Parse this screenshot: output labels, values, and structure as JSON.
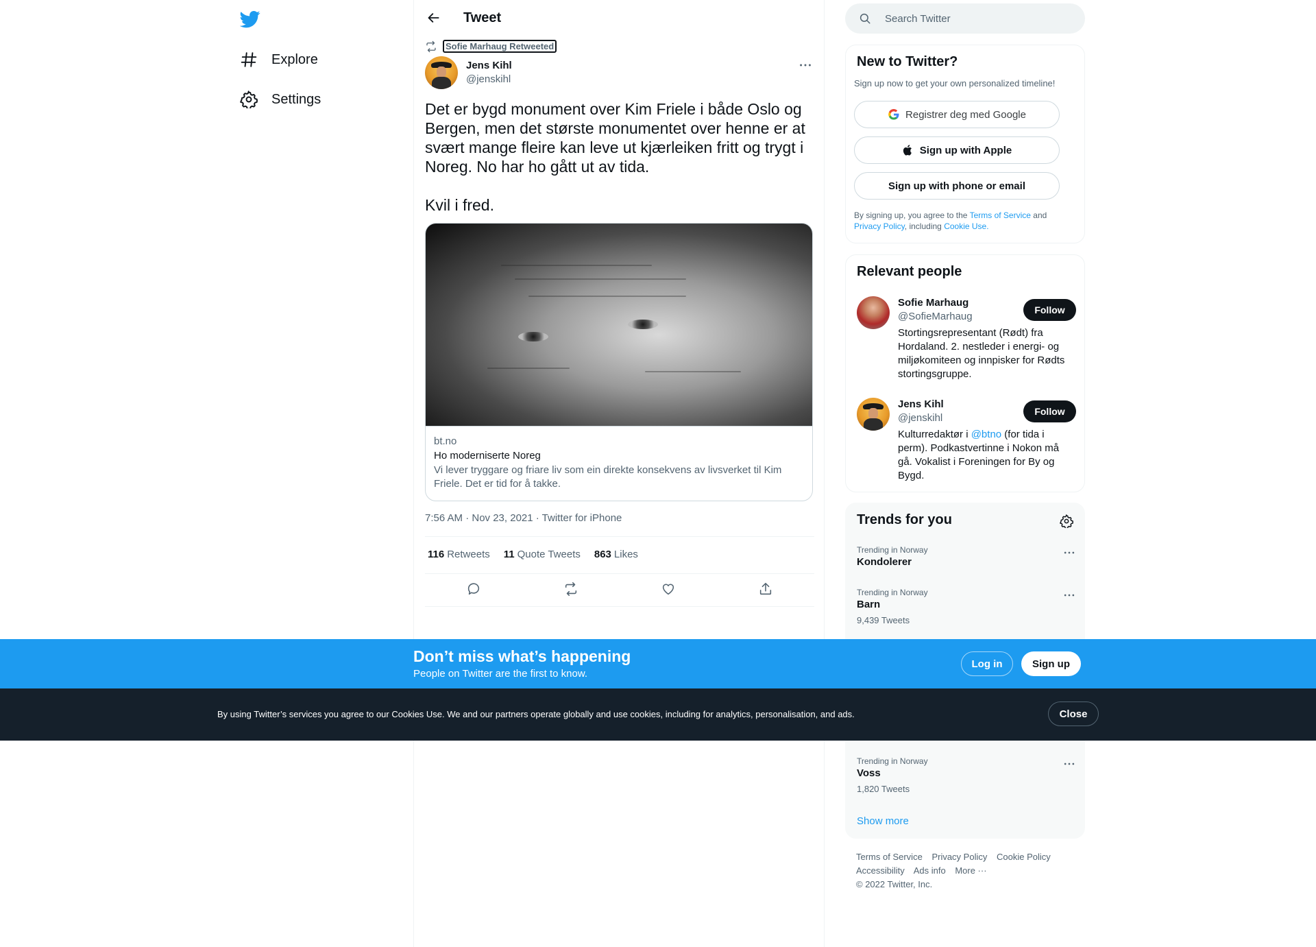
{
  "nav": {
    "explore_label": "Explore",
    "settings_label": "Settings"
  },
  "header": {
    "title": "Tweet"
  },
  "tweet": {
    "retweeted_by": "Sofie Marhaug Retweeted",
    "author_name": "Jens Kihl",
    "author_handle": "@jenskihl",
    "text": "Det er bygd monument over Kim Friele i både Oslo og Bergen, men det største monumentet over henne er at svært mange fleire kan leve ut kjærleiken fritt og trygt i Noreg. No har ho gått ut av tida.\n\nKvil i fred.",
    "card": {
      "domain": "bt.no",
      "title": "Ho moderniserte Noreg",
      "description": "Vi lever tryggare og friare liv som ein direkte konsekvens av livsverket til Kim Friele. Det er tid for å takke."
    },
    "timestamp": "7:56 AM · Nov 23, 2021 · Twitter for iPhone",
    "stats": {
      "retweets_count": "116",
      "retweets_label": "Retweets",
      "quotes_count": "11",
      "quotes_label": "Quote Tweets",
      "likes_count": "863",
      "likes_label": "Likes"
    }
  },
  "search": {
    "placeholder": "Search Twitter"
  },
  "signup_panel": {
    "title": "New to Twitter?",
    "subtitle": "Sign up now to get your own personalized timeline!",
    "google_label": "Registrer deg med Google",
    "apple_label": "Sign up with Apple",
    "phone_label": "Sign up with phone or email",
    "legal_prefix": "By signing up, you agree to the",
    "terms": "Terms of Service",
    "and": "and",
    "privacy": "Privacy Policy",
    "including": ", including",
    "cookie_use": "Cookie Use."
  },
  "people_panel": {
    "title": "Relevant people",
    "people": [
      {
        "name": "Sofie Marhaug",
        "handle": "@SofieMarhaug",
        "bio": "Stortingsrepresentant (Rødt) fra Hordaland. 2. nestleder i energi- og miljøkomiteen og innpisker for Rødts stortingsgruppe.",
        "follow": "Follow"
      },
      {
        "name": "Jens Kihl",
        "handle": "@jenskihl",
        "bio_prefix": "Kulturredaktør i ",
        "bio_mention": "@btno",
        "bio_suffix": " (for tida i perm). Podkastvertinne i Nokon må gå. Vokalist i Foreningen for By og Bygd.",
        "follow": "Follow"
      }
    ]
  },
  "trends_panel": {
    "title": "Trends for you",
    "trends": [
      {
        "context": "Trending in Norway",
        "name": "Kondolerer",
        "count": ""
      },
      {
        "context": "Trending in Norway",
        "name": "Barn",
        "count": "9,439 Tweets"
      },
      {
        "context": "Trending in Norway",
        "name": "Voss",
        "count": "1,820 Tweets"
      }
    ],
    "show_more": "Show more"
  },
  "footer": {
    "terms": "Terms of Service",
    "privacy": "Privacy Policy",
    "cookie": "Cookie Policy",
    "accessibility": "Accessibility",
    "ads": "Ads info",
    "more": "More ···",
    "copyright": "© 2022 Twitter, Inc."
  },
  "bottom_bar": {
    "title": "Don’t miss what’s happening",
    "subtitle": "People on Twitter are the first to know.",
    "login": "Log in",
    "signup": "Sign up"
  },
  "cookie_bar": {
    "text": "By using Twitter’s services you agree to our Cookies Use. We and our partners operate globally and use cookies, including for analytics, personalisation, and ads.",
    "close": "Close"
  },
  "colors": {
    "accent": "#1d9bf0",
    "text": "#0f1419",
    "secondary": "#536471",
    "cookie_bg": "#15202b"
  }
}
